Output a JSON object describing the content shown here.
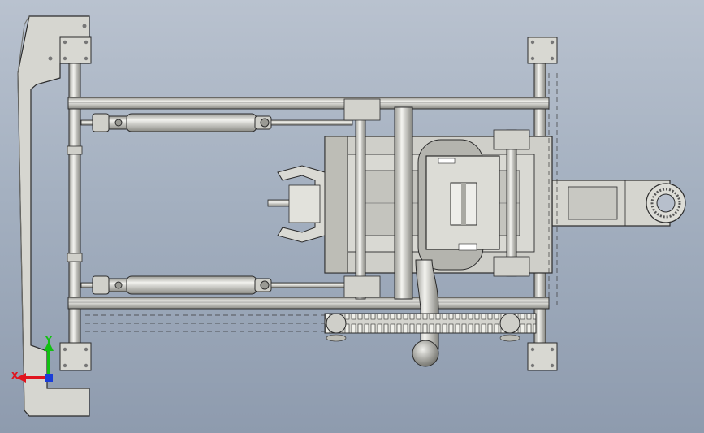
{
  "viewport": {
    "background_top": "#b9c2cf",
    "background_bottom": "#8e9bae"
  },
  "model": {
    "part_fill": "#d8d8d2",
    "part_shade": "#bfbfb8",
    "edge_color": "#2b2b2b",
    "metal_light": "#eeeeea",
    "metal_dark": "#8c8c86"
  },
  "triad": {
    "x_label": "X",
    "y_label": "Y",
    "x_color": "#e0141e",
    "y_color": "#12c012",
    "z_color": "#1a3dd8"
  }
}
